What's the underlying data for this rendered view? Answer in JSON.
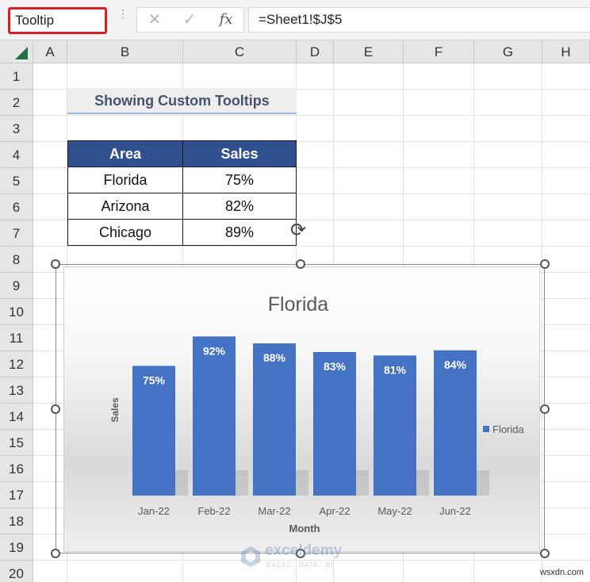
{
  "formula_bar": {
    "name_box": "Tooltip",
    "cancel_icon": "✕",
    "enter_icon": "✓",
    "fx_label": "fx",
    "formula": "=Sheet1!$J$5"
  },
  "sheet": {
    "columns": [
      "A",
      "B",
      "C",
      "D",
      "E",
      "F",
      "G",
      "H"
    ],
    "rows": [
      "1",
      "2",
      "3",
      "4",
      "5",
      "6",
      "7",
      "8",
      "9",
      "10",
      "11",
      "12",
      "13",
      "14",
      "15",
      "16",
      "17",
      "18",
      "19",
      "20"
    ],
    "heading": "Showing Custom Tooltips",
    "table": {
      "headers": [
        "Area",
        "Sales"
      ],
      "rows": [
        [
          "Florida",
          "75%"
        ],
        [
          "Arizona",
          "82%"
        ],
        [
          "Chicago",
          "89%"
        ]
      ]
    }
  },
  "chart_data": {
    "type": "bar",
    "title": "Florida",
    "xlabel": "Month",
    "ylabel": "Sales",
    "categories": [
      "Jan-22",
      "Feb-22",
      "Mar-22",
      "Apr-22",
      "May-22",
      "Jun-22"
    ],
    "series": [
      {
        "name": "Florida",
        "values": [
          0.75,
          0.92,
          0.88,
          0.83,
          0.81,
          0.84
        ],
        "labels": [
          "75%",
          "92%",
          "88%",
          "83%",
          "81%",
          "84%"
        ],
        "color": "#4472c4"
      }
    ],
    "ylim": [
      0,
      1.05
    ],
    "grid": false,
    "legend": "right"
  },
  "watermark": {
    "brand": "exceldemy",
    "tagline": "EXCEL · DATA · BI",
    "site": "wsxdn.com"
  }
}
